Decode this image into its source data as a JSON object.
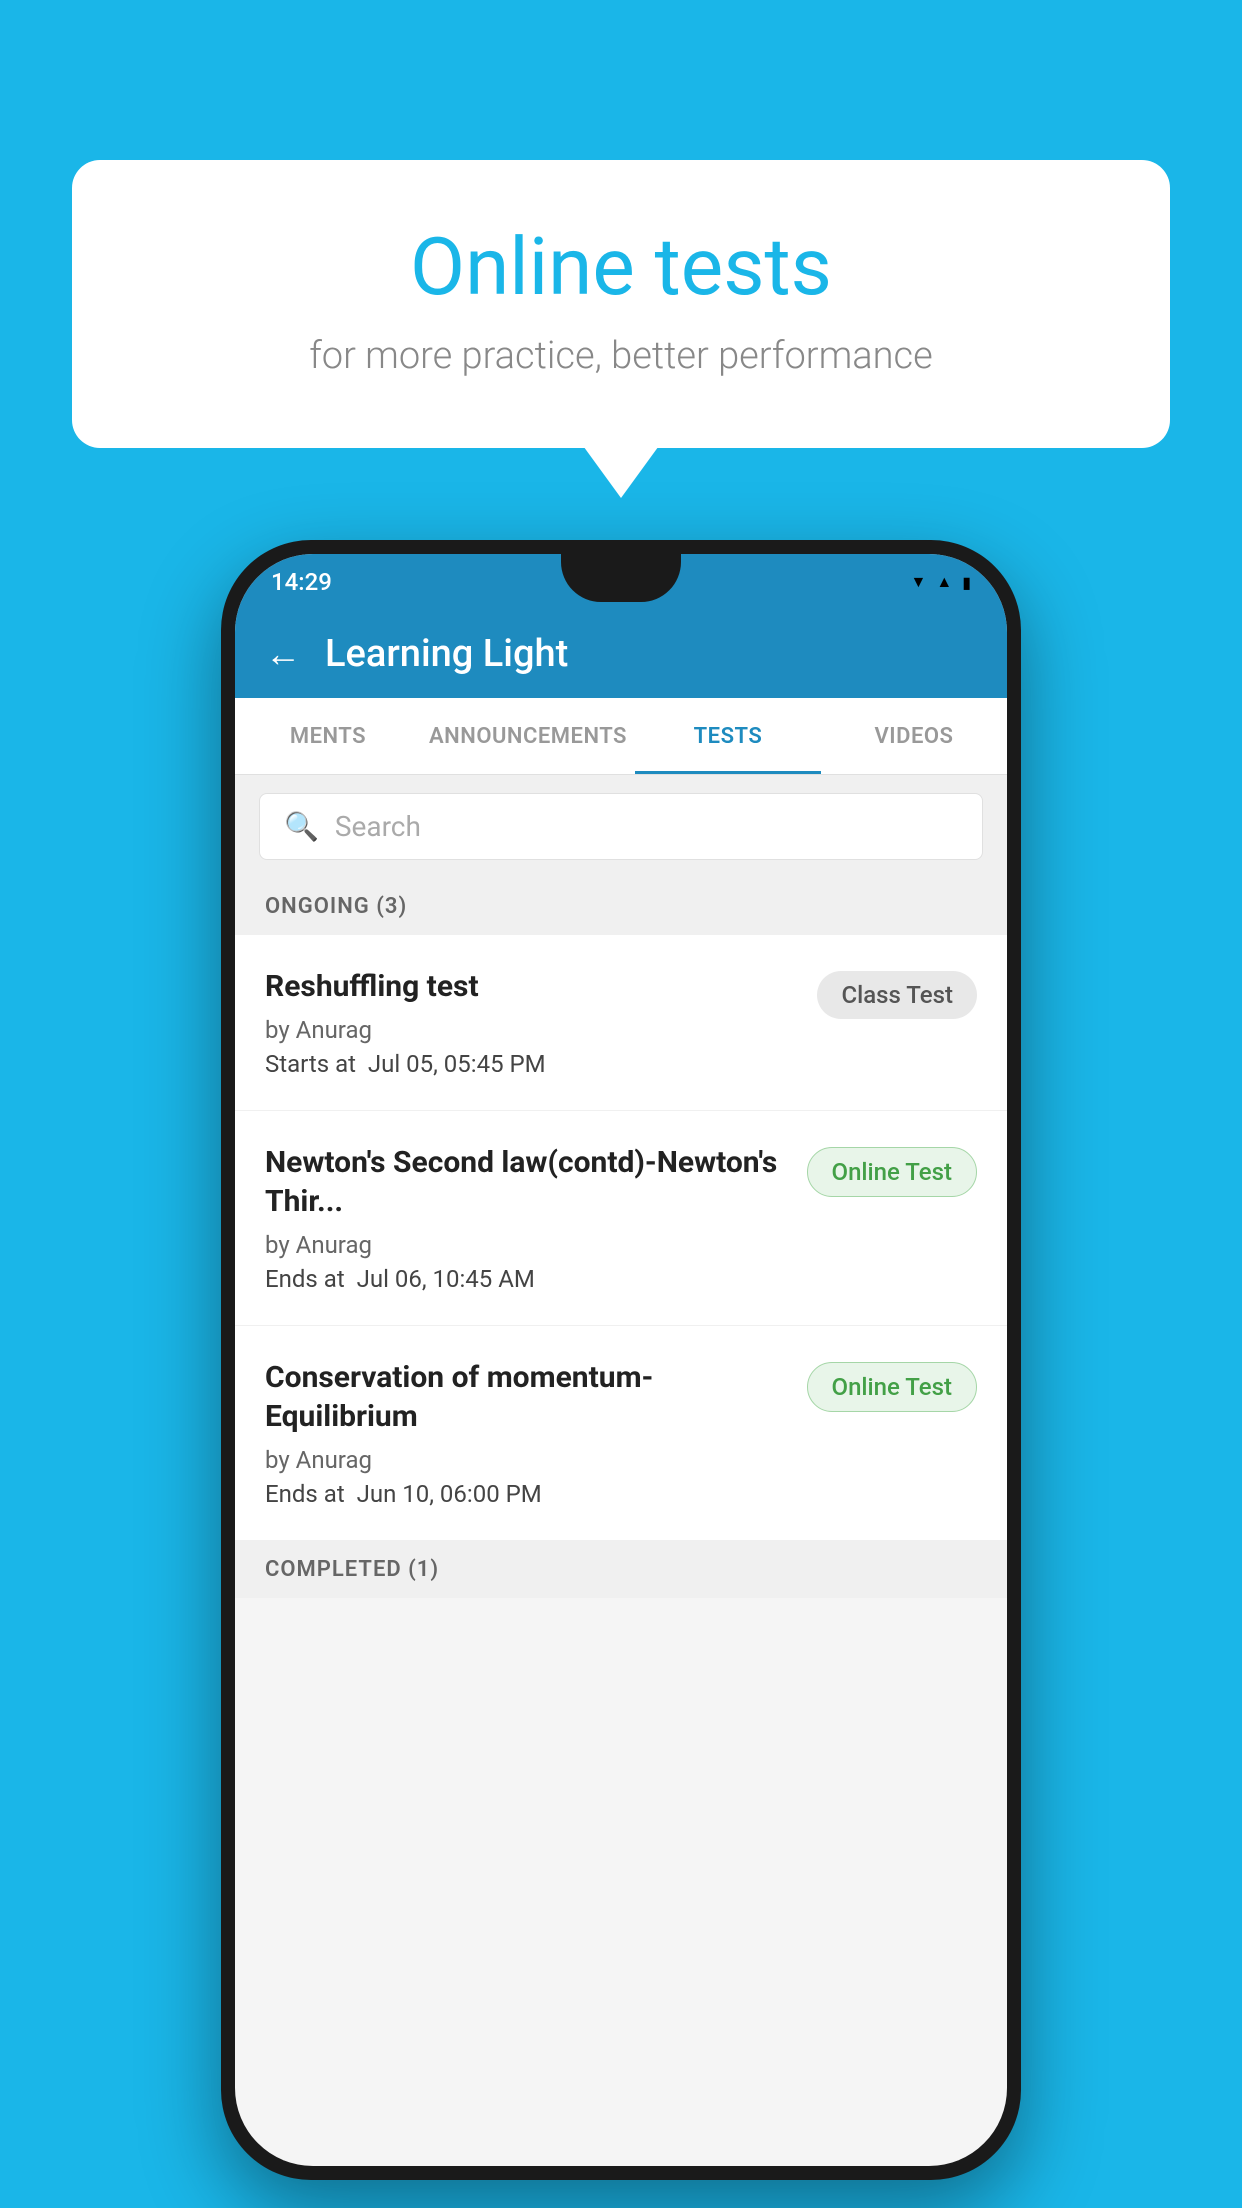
{
  "background": {
    "color": "#1ab6e8"
  },
  "speech_bubble": {
    "title": "Online tests",
    "subtitle": "for more practice, better performance"
  },
  "phone": {
    "status_bar": {
      "time": "14:29",
      "wifi": "▾",
      "signal": "▲",
      "battery": "▮"
    },
    "header": {
      "back_label": "←",
      "title": "Learning Light"
    },
    "tabs": [
      {
        "label": "MENTS",
        "active": false
      },
      {
        "label": "ANNOUNCEMENTS",
        "active": false
      },
      {
        "label": "TESTS",
        "active": true
      },
      {
        "label": "VIDEOS",
        "active": false
      }
    ],
    "search": {
      "placeholder": "Search"
    },
    "ongoing_section": {
      "label": "ONGOING (3)"
    },
    "tests": [
      {
        "name": "Reshuffling test",
        "author": "by Anurag",
        "date_label": "Starts at",
        "date": "Jul 05, 05:45 PM",
        "badge": "Class Test",
        "badge_type": "class"
      },
      {
        "name": "Newton's Second law(contd)-Newton's Thir...",
        "author": "by Anurag",
        "date_label": "Ends at",
        "date": "Jul 06, 10:45 AM",
        "badge": "Online Test",
        "badge_type": "online"
      },
      {
        "name": "Conservation of momentum-Equilibrium",
        "author": "by Anurag",
        "date_label": "Ends at",
        "date": "Jun 10, 06:00 PM",
        "badge": "Online Test",
        "badge_type": "online"
      }
    ],
    "completed_section": {
      "label": "COMPLETED (1)"
    }
  }
}
